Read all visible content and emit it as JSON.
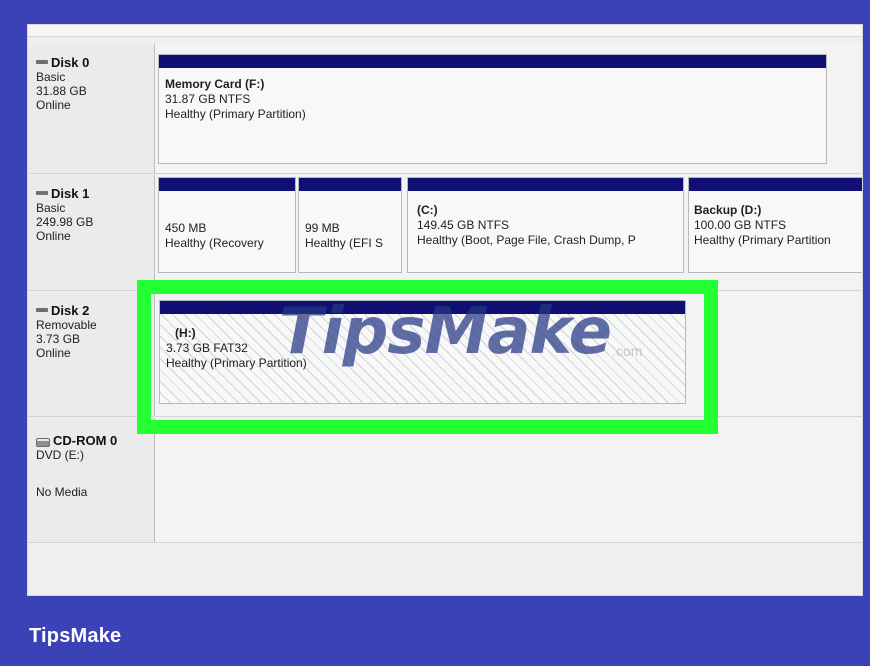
{
  "disk_management": {
    "disk0": {
      "title": "Disk 0",
      "type": "Basic",
      "size": "31.88 GB",
      "status": "Online",
      "partitions": [
        {
          "name": "Memory Card  (F:)",
          "fs": "31.87 GB NTFS",
          "health": "Healthy (Primary Partition)"
        }
      ]
    },
    "disk1": {
      "title": "Disk 1",
      "type": "Basic",
      "size": "249.98 GB",
      "status": "Online",
      "partitions": [
        {
          "name": "",
          "fs": "450 MB",
          "health": "Healthy (Recovery"
        },
        {
          "name": "",
          "fs": "99 MB",
          "health": "Healthy (EFI S"
        },
        {
          "name": "(C:)",
          "fs": "149.45 GB NTFS",
          "health": "Healthy (Boot, Page File, Crash Dump, P"
        },
        {
          "name": "Backup  (D:)",
          "fs": "100.00 GB NTFS",
          "health": "Healthy (Primary Partition"
        }
      ]
    },
    "disk2": {
      "title": "Disk 2",
      "type": "Removable",
      "size": "3.73 GB",
      "status": "Online",
      "partitions": [
        {
          "name": "(H:)",
          "fs": "3.73 GB FAT32",
          "health": "Healthy (Primary Partition)"
        }
      ]
    },
    "cdrom0": {
      "title": "CD-ROM 0",
      "drive": "DVD (E:)",
      "media": "No Media"
    }
  },
  "watermark": {
    "text": "TipsMake",
    "suffix": ".com"
  },
  "footer": {
    "brand": "TipsMake"
  },
  "colors": {
    "background": "#3b42b8",
    "highlight": "#22ff32",
    "partition_header": "#0f0f74",
    "panel": "#efefef"
  }
}
